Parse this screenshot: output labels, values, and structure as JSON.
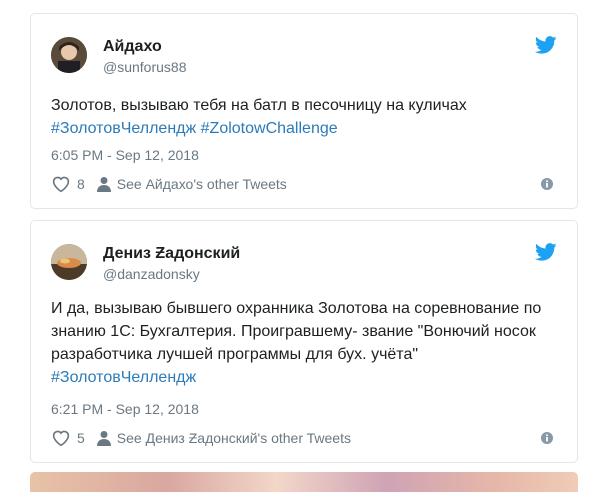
{
  "tweets": [
    {
      "author_name": "Айдахо",
      "author_handle": "@sunforus88",
      "text_plain": "Золотов, вызываю тебя на батл в песочницу на куличах ",
      "hashtags": [
        "#ЗолотовЧеллендж",
        "#ZolotowChallenge"
      ],
      "timestamp": "6:05 PM - Sep 12, 2018",
      "likes": "8",
      "other_tweets": "See Айдахо's other Tweets",
      "avatar_icon": "avatar-photo",
      "platform_icon": "twitter-bird-icon"
    },
    {
      "author_name": "Дениз Ƶадонский",
      "author_handle": "@danzadonsky",
      "text_plain": "И да, вызываю бывшего охранника Золотова на соревнование по знанию 1С: Бухгалтерия. Проигравшему- звание \"Вонючий носок разработчика лучшей программы для бух. учёта\" ",
      "hashtags": [
        "#ЗолотовЧеллендж"
      ],
      "timestamp": "6:21 PM - Sep 12, 2018",
      "likes": "5",
      "other_tweets": "See Дениз Ƶадонский's other Tweets",
      "avatar_icon": "avatar-photo",
      "platform_icon": "twitter-bird-icon"
    }
  ],
  "colors": {
    "text": "#1c2022",
    "secondary": "#697882",
    "link": "#2b7bb9",
    "twitter_blue": "#1da1f2",
    "border": "#e1e8ed"
  }
}
